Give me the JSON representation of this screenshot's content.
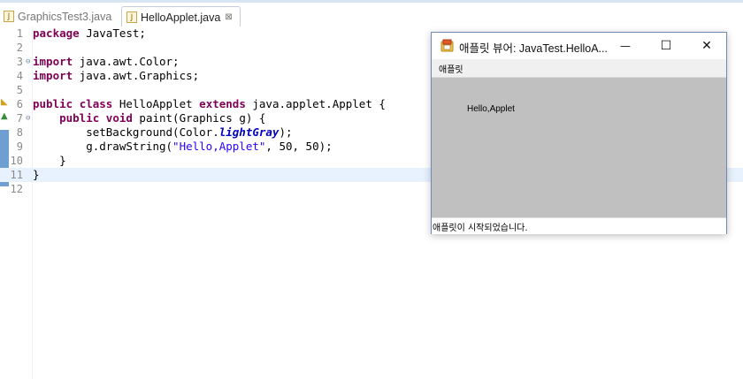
{
  "tabs": [
    {
      "label": "GraphicsTest3.java",
      "active": false
    },
    {
      "label": "HelloApplet.java",
      "active": true,
      "close": "⊠"
    }
  ],
  "editor": {
    "lines": [
      {
        "n": "1",
        "tokens": [
          {
            "t": "kw",
            "v": "package"
          },
          {
            "t": "p",
            "v": " JavaTest;"
          }
        ]
      },
      {
        "n": "2",
        "tokens": []
      },
      {
        "n": "3",
        "fold": "⊖",
        "tokens": [
          {
            "t": "kw",
            "v": "import"
          },
          {
            "t": "p",
            "v": " java.awt.Color;"
          }
        ]
      },
      {
        "n": "4",
        "tokens": [
          {
            "t": "kw",
            "v": "import"
          },
          {
            "t": "p",
            "v": " java.awt.Graphics;"
          }
        ]
      },
      {
        "n": "5",
        "tokens": []
      },
      {
        "n": "6",
        "tokens": [
          {
            "t": "kw",
            "v": "public"
          },
          {
            "t": "p",
            "v": " "
          },
          {
            "t": "kw",
            "v": "class"
          },
          {
            "t": "p",
            "v": " HelloApplet "
          },
          {
            "t": "kw",
            "v": "extends"
          },
          {
            "t": "p",
            "v": " java.applet.Applet {"
          }
        ]
      },
      {
        "n": "7",
        "fold": "⊖",
        "tokens": [
          {
            "t": "p",
            "v": "    "
          },
          {
            "t": "kw",
            "v": "public"
          },
          {
            "t": "p",
            "v": " "
          },
          {
            "t": "kw",
            "v": "void"
          },
          {
            "t": "p",
            "v": " paint(Graphics g) {"
          }
        ]
      },
      {
        "n": "8",
        "tokens": [
          {
            "t": "p",
            "v": "        setBackground(Color."
          },
          {
            "t": "fld",
            "v": "lightGray"
          },
          {
            "t": "p",
            "v": ");"
          }
        ]
      },
      {
        "n": "9",
        "tokens": [
          {
            "t": "p",
            "v": "        g.drawString("
          },
          {
            "t": "str",
            "v": "\"Hello,Applet\""
          },
          {
            "t": "p",
            "v": ", 50, 50);"
          }
        ]
      },
      {
        "n": "10",
        "tokens": [
          {
            "t": "p",
            "v": "    }"
          }
        ]
      },
      {
        "n": "11",
        "current": true,
        "tokens": [
          {
            "t": "p",
            "v": "}"
          }
        ]
      },
      {
        "n": "12",
        "tokens": []
      }
    ]
  },
  "applet_window": {
    "title": "애플릿 뷰어: JavaTest.HelloA...",
    "minimize": "—",
    "maximize": "☐",
    "close": "✕",
    "menu_label": "애플릿",
    "canvas_text": "Hello,Applet",
    "canvas_color": "#c0c0c0",
    "status": "애플릿이 시작되었습니다."
  }
}
